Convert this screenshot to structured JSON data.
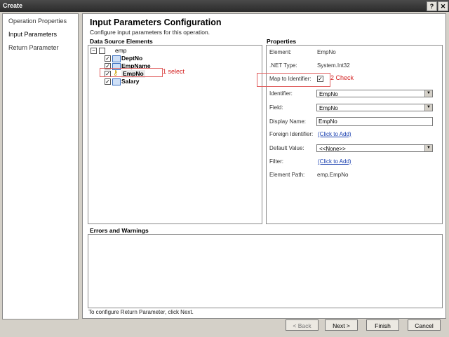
{
  "window": {
    "title": "Create",
    "help_glyph": "?",
    "close_glyph": "✕"
  },
  "nav": {
    "items": [
      "Operation Properties",
      "Input Parameters",
      "Return Parameter"
    ]
  },
  "header": {
    "title": "Input Parameters Configuration",
    "subtitle": "Configure input parameters for this operation."
  },
  "dse": {
    "title": "Data Source Elements",
    "root": "emp",
    "items": [
      {
        "label": "DeptNo",
        "checked": true
      },
      {
        "label": "EmpName",
        "checked": true
      },
      {
        "label": "EmpNo",
        "checked": true,
        "icon": "key-icon"
      },
      {
        "label": "Salary",
        "checked": true
      }
    ],
    "annotation": "1 select"
  },
  "props": {
    "title": "Properties",
    "element_label": "Element:",
    "element_value": "EmpNo",
    "nettype_label": ".NET Type:",
    "nettype_value": "System.Int32",
    "map_label": "Map to Identifier:",
    "map_checked": true,
    "identifier_label": "Identifier:",
    "identifier_value": "EmpNo",
    "field_label": "Field:",
    "field_value": "EmpNo",
    "display_label": "Display Name:",
    "display_value": "EmpNo",
    "foreign_label": "Foreign Identifier:",
    "foreign_link": "(Click to Add)",
    "default_label": "Default Value:",
    "default_value": "<<None>>",
    "filter_label": "Filter:",
    "filter_link": "(Click to Add)",
    "path_label": "Element Path:",
    "path_value": "emp.EmpNo",
    "annotation": "2 Check"
  },
  "errors": {
    "title": "Errors and Warnings"
  },
  "footer": {
    "text": "To configure Return Parameter, click Next."
  },
  "buttons": {
    "back": "< Back",
    "next": "Next >",
    "finish": "Finish",
    "cancel": "Cancel"
  },
  "colors": {
    "annotation": "#d32020",
    "link": "#1a40b0"
  }
}
